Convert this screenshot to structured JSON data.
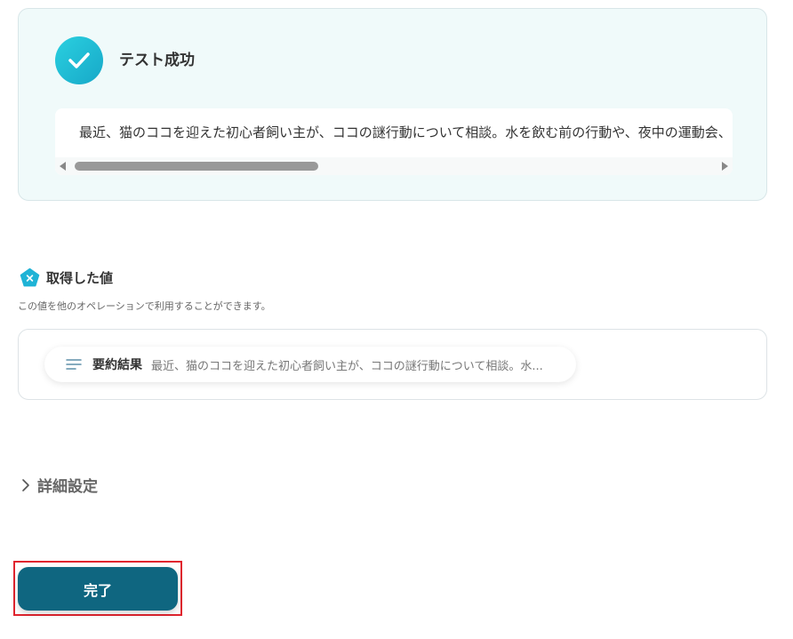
{
  "result": {
    "title": "テスト成功",
    "output_text": "最近、猫のココを迎えた初心者飼い主が、ココの謎行動について相談。水を飲む前の行動や、夜中の運動会、"
  },
  "retrieved": {
    "title": "取得した値",
    "description": "この値を他のオペレーションで利用することができます。",
    "items": [
      {
        "label": "要約結果",
        "value": "最近、猫のココを迎えた初心者飼い主が、ココの謎行動について相談。水..."
      }
    ]
  },
  "advanced": {
    "label": "詳細設定"
  },
  "footer": {
    "done_label": "完了"
  },
  "colors": {
    "success_accent": "#17a8c8",
    "primary_button": "#0f6680",
    "focus_outline": "#e0242e",
    "card_background": "#f0fafa"
  },
  "icons": {
    "success": "check-icon",
    "section": "variable-pentagon-icon",
    "value": "text-lines-icon",
    "expand": "chevron-right-icon"
  }
}
